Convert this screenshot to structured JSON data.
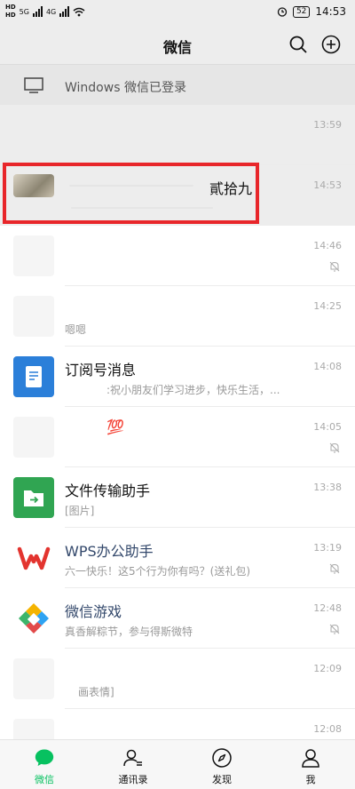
{
  "status_bar": {
    "sim1": "HD",
    "sim2": "HD",
    "net1": "5G",
    "net2": "4G",
    "battery": "52",
    "time": "14:53"
  },
  "header": {
    "title": "微信",
    "search_icon": "search-icon",
    "add_icon": "add-circle-icon"
  },
  "login_banner": {
    "text": "Windows 微信已登录",
    "icon": "monitor-icon"
  },
  "chats": [
    {
      "name": "",
      "preview": "",
      "time": "13:59",
      "muted": false
    },
    {
      "name": "貳拾九",
      "preview": "",
      "time": "14:53",
      "muted": false
    },
    {
      "name": "",
      "preview": "",
      "time": "14:46",
      "muted": true
    },
    {
      "name": "",
      "preview": "嗯嗯",
      "time": "14:25",
      "muted": false
    },
    {
      "name": "订阅号消息",
      "preview": ":祝小朋友们学习进步，快乐生活，...",
      "time": "14:08",
      "muted": false
    },
    {
      "name": "💯",
      "preview": "",
      "time": "14:05",
      "muted": true
    },
    {
      "name": "文件传输助手",
      "preview": "[图片]",
      "time": "13:38",
      "muted": false
    },
    {
      "name": "WPS办公助手",
      "preview": "六一快乐！这5个行为你有吗？(送礼包)",
      "time": "13:19",
      "muted": true
    },
    {
      "name": "微信游戏",
      "preview": "真香解粽节，参与得斯微特",
      "time": "12:48",
      "muted": true
    },
    {
      "name": "",
      "preview": "画表情]",
      "time": "12:09",
      "muted": false
    },
    {
      "name": "",
      "preview": "",
      "time": "12:08",
      "muted": false
    }
  ],
  "tabs": [
    {
      "label": "微信",
      "icon": "chat-bubble-icon",
      "active": true
    },
    {
      "label": "通讯录",
      "icon": "contacts-icon",
      "active": false
    },
    {
      "label": "发现",
      "icon": "compass-icon",
      "active": false
    },
    {
      "label": "我",
      "icon": "person-icon",
      "active": false
    }
  ],
  "colors": {
    "accent": "#07c160",
    "highlight": "#e8262a",
    "subscription_blue": "#2b7fd9",
    "file_transfer_green": "#30a552"
  }
}
